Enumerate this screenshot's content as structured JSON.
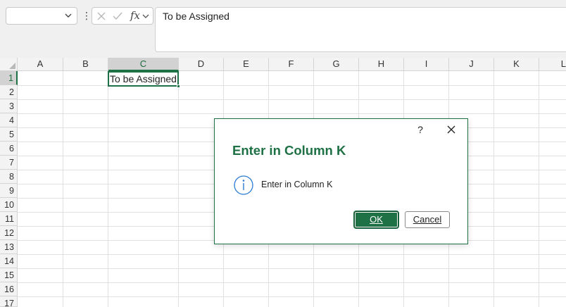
{
  "formula_bar": {
    "name_box_value": "",
    "more_icon": "vertical-dots-icon",
    "cancel_icon": "x-icon",
    "enter_icon": "checkmark-icon",
    "function_label": "fx",
    "content": "To be Assigned"
  },
  "grid": {
    "columns": [
      "A",
      "B",
      "C",
      "D",
      "E",
      "F",
      "G",
      "H",
      "I",
      "J",
      "K",
      "L"
    ],
    "rows": [
      "1",
      "2",
      "3",
      "4",
      "5",
      "6",
      "7",
      "8",
      "9",
      "10",
      "11",
      "12",
      "13",
      "14",
      "15",
      "16",
      "17"
    ],
    "selected_column": "C",
    "selected_row": "1",
    "cells": {
      "C1": "To be Assigned"
    }
  },
  "dialog": {
    "help_label": "?",
    "title": "Enter in Column K",
    "icon": "info-icon",
    "message": "Enter in Column K",
    "ok_label": "OK",
    "cancel_label": "Cancel"
  },
  "colors": {
    "accent": "#1e7145",
    "header_bg": "#f3f3f3",
    "gridline": "#e1e1e1"
  }
}
